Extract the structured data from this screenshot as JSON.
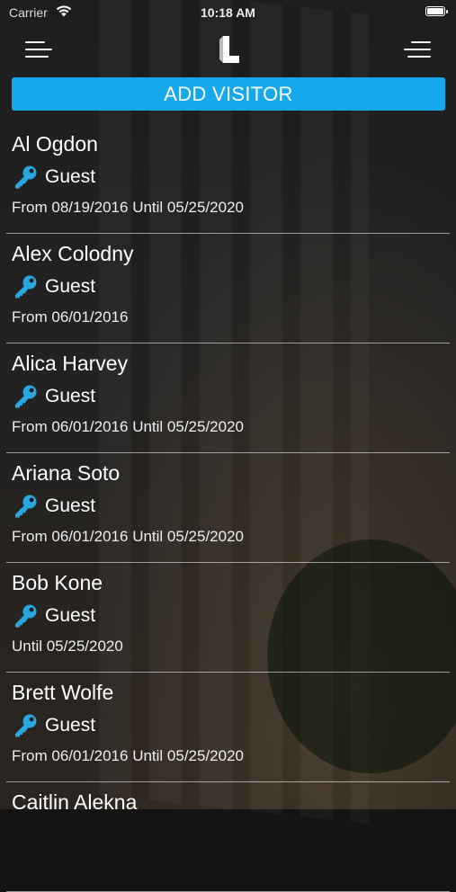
{
  "status_bar": {
    "carrier": "Carrier",
    "time": "10:18 AM",
    "battery_level": 1.0
  },
  "header": {
    "left_menu_icon": "hamburger-icon",
    "logo_icon": "logo-L-icon",
    "right_menu_icon": "menu-icon"
  },
  "add_visitor": {
    "label": "ADD VISITOR",
    "color": "#15a9ec"
  },
  "visitors": [
    {
      "name": "Al Ogdon",
      "role": "Guest",
      "dates": "From 08/19/2016 Until 05/25/2020"
    },
    {
      "name": "Alex Colodny",
      "role": "Guest",
      "dates": "From 06/01/2016"
    },
    {
      "name": "Alica Harvey",
      "role": "Guest",
      "dates": "From 06/01/2016 Until 05/25/2020"
    },
    {
      "name": "Ariana Soto",
      "role": "Guest",
      "dates": "From 06/01/2016 Until 05/25/2020"
    },
    {
      "name": "Bob Kone",
      "role": "Guest",
      "dates": "Until 05/25/2020"
    },
    {
      "name": "Brett Wolfe",
      "role": "Guest",
      "dates": "From 06/01/2016 Until 05/25/2020"
    },
    {
      "name": "Caitlin Alekna",
      "role": "",
      "dates": ""
    }
  ],
  "key_icon": "key-icon",
  "key_color": "#29a8e0"
}
